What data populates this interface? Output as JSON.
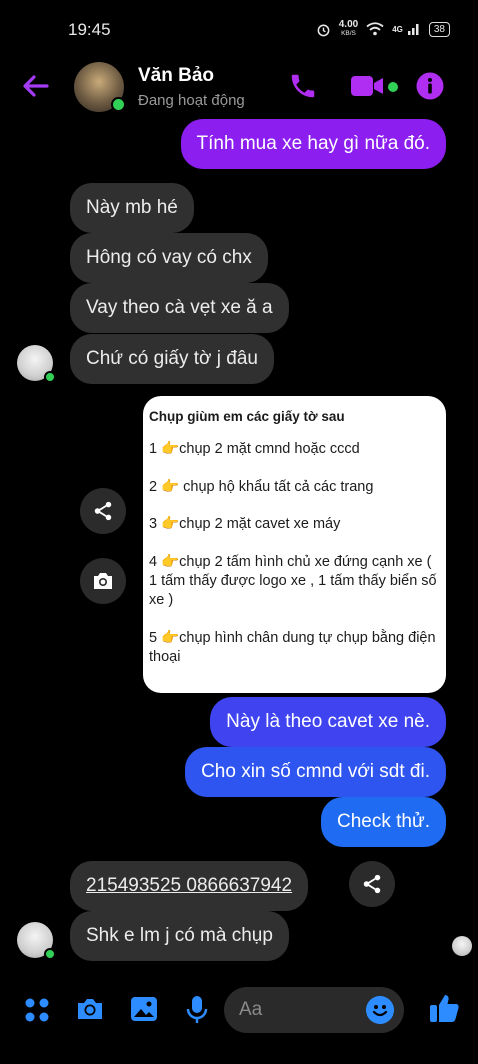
{
  "status_bar": {
    "time": "19:45",
    "speed": "4.00",
    "speed_unit": "KB/S",
    "network": "4G",
    "battery": "38"
  },
  "header": {
    "name": "Văn Bảo",
    "status": "Đang hoạt động",
    "icons": [
      "back-arrow-icon",
      "phone-icon",
      "video-camera-icon",
      "info-icon"
    ]
  },
  "messages": [
    {
      "from": "me",
      "text": "Tính mua xe hay gì nữa đó."
    },
    {
      "from": "them",
      "text": "Này mb hé"
    },
    {
      "from": "them",
      "text": "Hông có vay có chx"
    },
    {
      "from": "them",
      "text": "Vay theo cà vẹt xe ă a"
    },
    {
      "from": "them",
      "text": "Chứ có giấy tờ j đâu"
    },
    {
      "from": "me",
      "text": "Này là theo cavet xe nè."
    },
    {
      "from": "me",
      "text": "Cho xin số cmnd với sdt đi."
    },
    {
      "from": "me",
      "text": "Check thử."
    },
    {
      "from": "them",
      "text": "215493525 0866637942"
    },
    {
      "from": "them",
      "text": "Shk e lm j có mà chụp"
    }
  ],
  "attached_image": {
    "title": "Chụp giùm em các giấy tờ sau",
    "lines": [
      "1 👉chụp 2 mặt cmnd hoặc cccd",
      "2 👉 chụp hộ khẩu tất cả các trang",
      "3 👉chụp 2 mặt cavet xe máy",
      "4 👉chụp 2 tấm hình chủ xe đứng cạnh xe ( 1 tấm thấy được logo xe , 1 tấm thấy biển số xe )",
      "5 👉chụp hình chân dung tự chụp bằng điện thoại"
    ]
  },
  "composer": {
    "placeholder": "Aa",
    "icons": [
      "apps-icon",
      "camera-icon",
      "gallery-icon",
      "microphone-icon",
      "emoji-icon",
      "thumbs-up-icon"
    ]
  },
  "colors": {
    "accent_purple": "#8c1ef0",
    "accent_blue": "#1f6cf2",
    "incoming_bubble": "#303030",
    "online_green": "#31d158"
  }
}
